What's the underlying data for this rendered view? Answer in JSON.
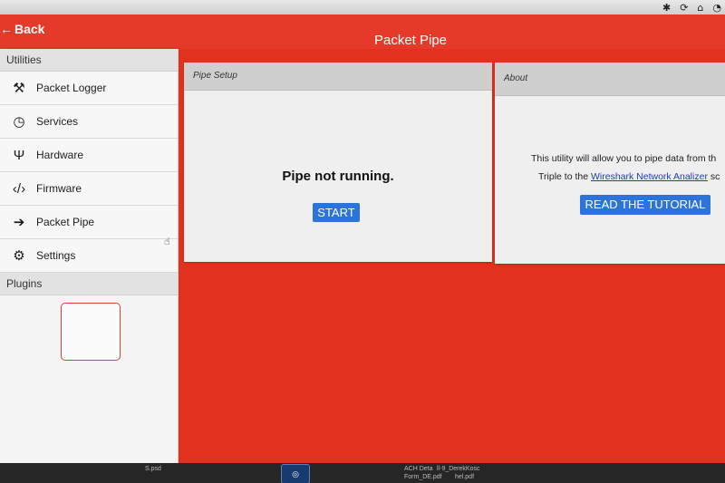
{
  "window": {
    "back_label": "Back",
    "title": "Packet Pipe"
  },
  "sidebar": {
    "utilities_header": "Utilities",
    "items": [
      {
        "label": "Packet Logger",
        "icon": "tools-icon"
      },
      {
        "label": "Services",
        "icon": "gauge-icon"
      },
      {
        "label": "Hardware",
        "icon": "usb-icon"
      },
      {
        "label": "Firmware",
        "icon": "code-icon"
      },
      {
        "label": "Packet Pipe",
        "icon": "arrow-right-icon"
      },
      {
        "label": "Settings",
        "icon": "gear-icon"
      }
    ],
    "plugins_header": "Plugins"
  },
  "pipe_setup": {
    "header": "Pipe Setup",
    "status": "Pipe not running.",
    "start_label": "START"
  },
  "about": {
    "header": "About",
    "line1": "This utility will allow you to pipe data from th",
    "line2_prefix": "Triple to the ",
    "link_text": "Wireshark Network Analizer",
    "line2_suffix": " sc",
    "tutorial_label": "READ THE TUTORIAL"
  },
  "dock": {
    "file1": "S.psd",
    "file2": "ACH Deta",
    "file2b": "Form_DE.pdf",
    "file3": "ll-9_DerekKosc",
    "file3b": "hel.pdf"
  },
  "colors": {
    "accent_red": "#e53a2a",
    "button_blue": "#2c74d8"
  }
}
